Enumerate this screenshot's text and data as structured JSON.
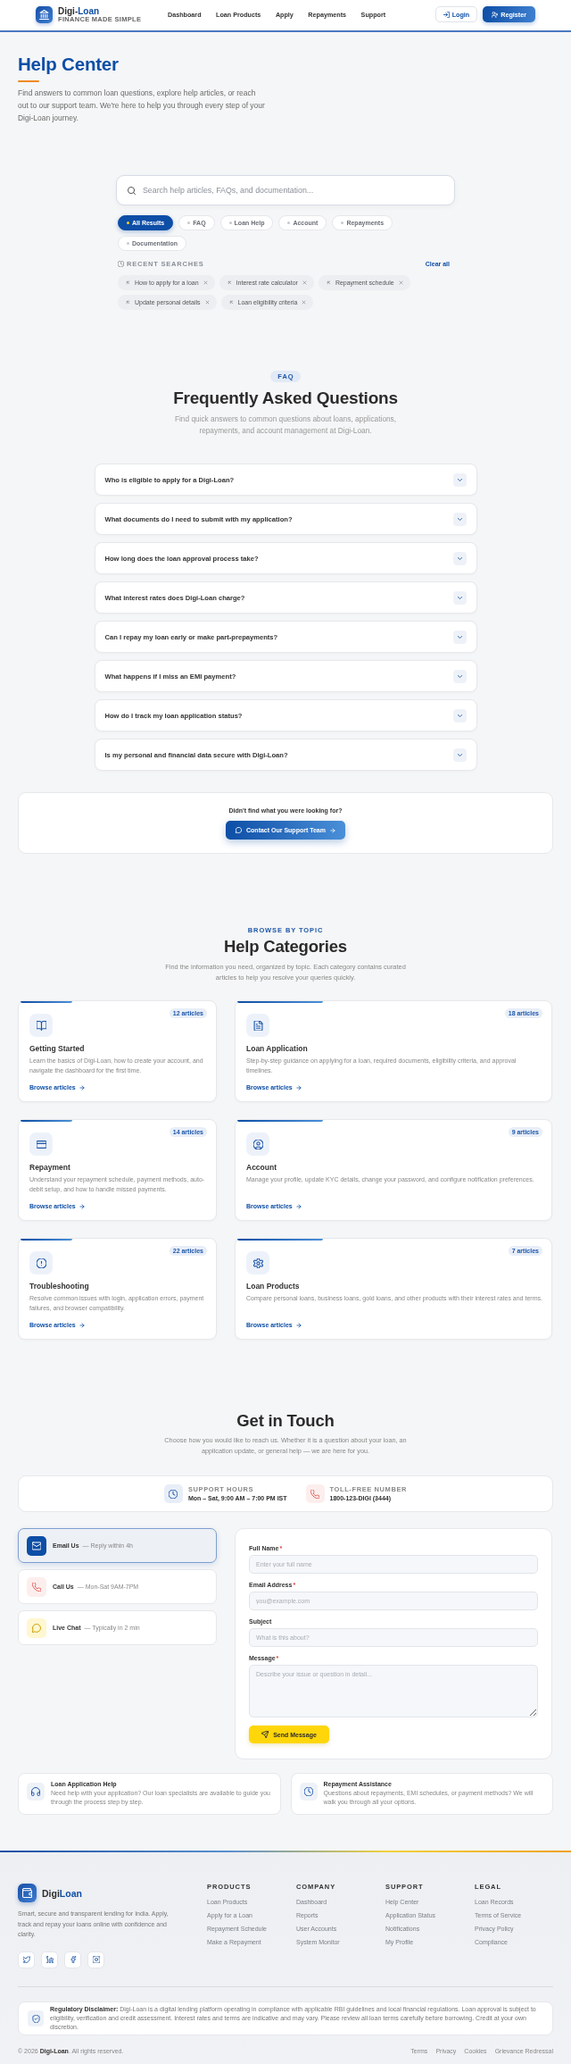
{
  "header": {
    "brand": {
      "name": "Digi-",
      "name_accent": "Loan",
      "tagline": "FINANCE MADE SIMPLE"
    },
    "nav": [
      "Dashboard",
      "Loan Products",
      "Apply",
      "Repayments",
      "Support"
    ],
    "login": "Login",
    "register": "Register"
  },
  "hero": {
    "title": "Help Center",
    "subtitle": "Find answers to common loan questions, explore help articles, or reach out to our support team. We're here to help you through every step of your Digi-Loan journey."
  },
  "search": {
    "placeholder": "Search help articles, FAQs, and documentation...",
    "filters": [
      {
        "label": "All Results",
        "selected": true
      },
      {
        "label": "FAQ",
        "selected": false
      },
      {
        "label": "Loan Help",
        "selected": false
      },
      {
        "label": "Account",
        "selected": false
      },
      {
        "label": "Repayments",
        "selected": false
      },
      {
        "label": "Documentation",
        "selected": false
      }
    ],
    "recent": {
      "title": "RECENT SEARCHES",
      "clear": "Clear all",
      "items": [
        "How to apply for a loan",
        "Interest rate calculator",
        "Repayment schedule",
        "Update personal details",
        "Loan eligibility criteria"
      ]
    }
  },
  "faq": {
    "badge": "FAQ",
    "title": "Frequently Asked Questions",
    "subtitle": "Find quick answers to common questions about loans, applications, repayments, and account management at Digi-Loan.",
    "items": [
      {
        "question": "Who is eligible to apply for a Digi-Loan?",
        "expanded": false
      },
      {
        "question": "What documents do I need to submit with my application?",
        "expanded": false
      },
      {
        "question": "How long does the loan approval process take?",
        "expanded": false
      },
      {
        "question": "What interest rates does Digi-Loan charge?",
        "expanded": false
      },
      {
        "question": "Can I repay my loan early or make part-prepayments?",
        "expanded": false
      },
      {
        "question": "What happens if I miss an EMI payment?",
        "expanded": false
      },
      {
        "question": "How do I track my loan application status?",
        "expanded": false
      },
      {
        "question": "Is my personal and financial data secure with Digi-Loan?",
        "expanded": false
      }
    ]
  },
  "contact_prompt": {
    "text": "Didn't find what you were looking for?",
    "button": "Contact Our Support Team"
  },
  "categories": {
    "eyebrow": "BROWSE BY TOPIC",
    "title": "Help Categories",
    "subtitle": "Find the information you need, organized by topic. Each category contains curated articles to help you resolve your queries quickly.",
    "items": [
      {
        "title": "Getting Started",
        "count": "12 articles",
        "description": "Learn the basics of Digi-Loan, how to create your account, and navigate the dashboard for the first time.",
        "link": "Browse articles"
      },
      {
        "title": "Loan Application",
        "count": "18 articles",
        "description": "Step-by-step guidance on applying for a loan, required documents, eligibility criteria, and approval timelines.",
        "link": "Browse articles"
      },
      {
        "title": "Repayment",
        "count": "14 articles",
        "description": "Understand your repayment schedule, payment methods, auto-debit setup, and how to handle missed payments.",
        "link": "Browse articles"
      },
      {
        "title": "Account",
        "count": "9 articles",
        "description": "Manage your profile, update KYC details, change your password, and configure notification preferences.",
        "link": "Browse articles"
      },
      {
        "title": "Troubleshooting",
        "count": "22 articles",
        "description": "Resolve common issues with login, application errors, payment failures, and browser compatibility.",
        "link": "Browse articles"
      },
      {
        "title": "Loan Products",
        "count": "7 articles",
        "description": "Compare personal loans, business loans, gold loans, and other products with their interest rates and terms.",
        "link": "Browse articles"
      }
    ]
  },
  "contact": {
    "title": "Get in Touch",
    "subtitle": "Choose how you would like to reach us. Whether it is a question about your loan, an application update, or general help — we are here for you.",
    "info": [
      {
        "label": "SUPPORT HOURS",
        "value": "Mon – Sat, 9:00 AM – 7:00 PM IST"
      },
      {
        "label": "TOLL-FREE NUMBER",
        "value": "1800-123-DIGI (3444)"
      }
    ],
    "channels": [
      {
        "name": "Email Us",
        "note": "— Reply within 4h",
        "selected": true
      },
      {
        "name": "Call Us",
        "note": "— Mon-Sat 9AM-7PM",
        "selected": false
      },
      {
        "name": "Live Chat",
        "note": "— Typically in 2 min",
        "selected": false
      }
    ],
    "form": {
      "fields": [
        {
          "label": "Full Name",
          "required_mark": "*",
          "kind": "text",
          "placeholder": "Enter your full name"
        },
        {
          "label": "Email Address",
          "required_mark": "*",
          "kind": "text",
          "placeholder": "you@example.com"
        },
        {
          "label": "Subject",
          "kind": "text",
          "placeholder": "What is this about?"
        },
        {
          "label": "Message",
          "required_mark": "*",
          "kind": "textarea",
          "placeholder": "Describe your issue or question in detail..."
        }
      ],
      "submit": "Send Message"
    },
    "help_cards": [
      {
        "title": "Loan Application Help",
        "description": "Need help with your application? Our loan specialists are available to guide you through the process step by step."
      },
      {
        "title": "Repayment Assistance",
        "description": "Questions about repayments, EMI schedules, or payment methods? We will walk you through all your options."
      }
    ]
  },
  "footer": {
    "brand": {
      "name": "Digi",
      "name_accent": "Loan"
    },
    "description": "Smart, secure and transparent lending for India. Apply, track and repay your loans online with confidence and clarity.",
    "columns": [
      {
        "title": "PRODUCTS",
        "links": [
          "Loan Products",
          "Apply for a Loan",
          "Repayment Schedule",
          "Make a Repayment"
        ]
      },
      {
        "title": "COMPANY",
        "links": [
          "Dashboard",
          "Reports",
          "User Accounts",
          "System Monitor"
        ]
      },
      {
        "title": "SUPPORT",
        "links": [
          "Help Center",
          "Application Status",
          "Notifications",
          "My Profile"
        ]
      },
      {
        "title": "LEGAL",
        "links": [
          "Loan Records",
          "Terms of Service",
          "Privacy Policy",
          "Compliance"
        ]
      }
    ],
    "disclaimer": "**Regulatory Disclaimer:** Digi-Loan is a digital lending platform operating in compliance with applicable RBI guidelines and local financial regulations. Loan approval is subject to eligibility, verification and credit assessment. Interest rates and terms are indicative and may vary. Please review all loan terms carefully before borrowing. Credit at your own discretion.",
    "copyright": "© 2026 **Digi-Loan**. All rights reserved.",
    "legal_links": [
      "Terms",
      "Privacy",
      "Cookies",
      "Grievance Redressal"
    ]
  }
}
